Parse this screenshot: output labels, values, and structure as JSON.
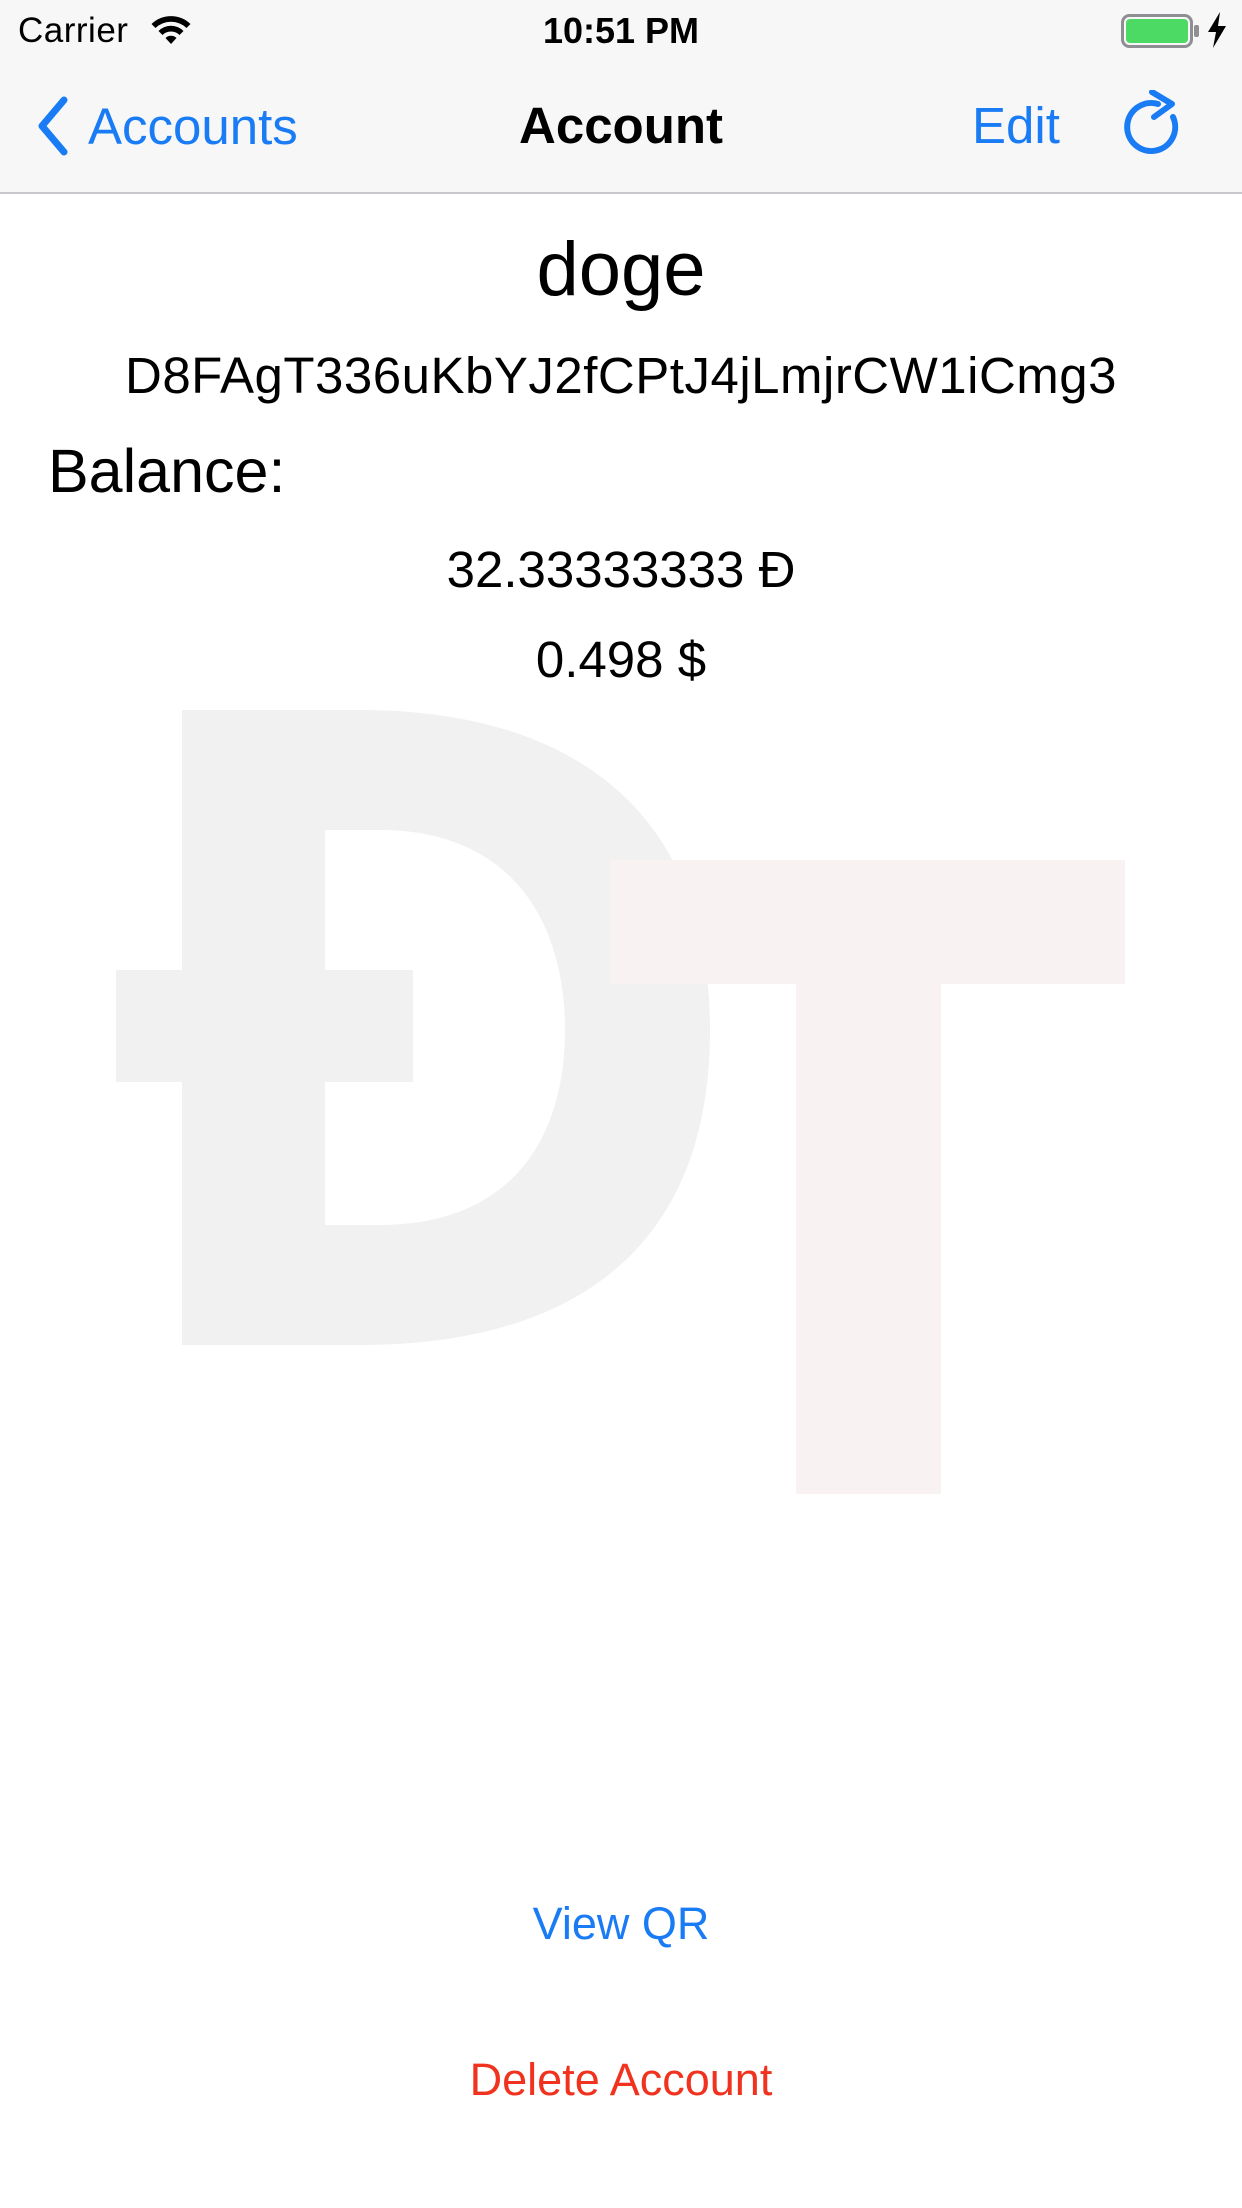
{
  "status_bar": {
    "carrier": "Carrier",
    "time": "10:51 PM",
    "wifi_icon": "wifi-icon",
    "battery_icon": "battery-charging-icon",
    "battery_level": 1.0
  },
  "nav": {
    "back_label": "Accounts",
    "title": "Account",
    "edit_label": "Edit",
    "refresh_icon": "refresh-icon",
    "back_icon": "chevron-left-icon"
  },
  "account": {
    "name": "doge",
    "address": "D8FAgT336uKbYJ2fCPtJ4jLmjrCW1iCmg3",
    "balance_label": "Balance:",
    "balance_doge": "32.33333333 Đ",
    "balance_usd": "0.498 $"
  },
  "watermark": {
    "icon": "dogecoin-logo-icon"
  },
  "actions": {
    "view_qr_label": "View QR",
    "delete_label": "Delete Account"
  },
  "colors": {
    "accent": "#1a7cf5",
    "destructive": "#f0321e",
    "battery_fill": "#4cd964",
    "bar_background": "#f7f7f7"
  }
}
